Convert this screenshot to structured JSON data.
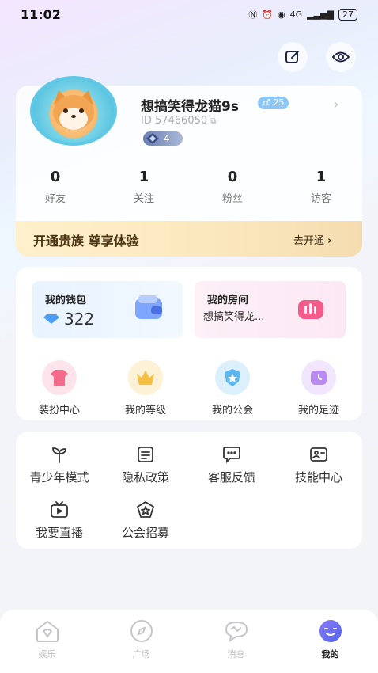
{
  "status": {
    "time": "11:02",
    "network": "4G",
    "battery": "27"
  },
  "profile": {
    "nickname": "想搞笑得龙猫9s",
    "gender_level": "♂ 25",
    "id_text": "ID 57466050",
    "level": "4"
  },
  "stats": [
    {
      "num": "0",
      "label": "好友"
    },
    {
      "num": "1",
      "label": "关注"
    },
    {
      "num": "0",
      "label": "粉丝"
    },
    {
      "num": "1",
      "label": "访客"
    }
  ],
  "vip": {
    "title": "开通贵族 尊享体验",
    "action": "去开通"
  },
  "wallet": {
    "title": "我的钱包",
    "balance": "322"
  },
  "room": {
    "title": "我的房间",
    "subtitle": "想搞笑得龙..."
  },
  "grid": [
    {
      "label": "装扮中心",
      "icon": "shirt-icon",
      "color": "#f56a8a"
    },
    {
      "label": "我的等级",
      "icon": "crown-icon",
      "color": "#f6c043"
    },
    {
      "label": "我的公会",
      "icon": "star-shield-icon",
      "color": "#5ab7ef"
    },
    {
      "label": "我的足迹",
      "icon": "clock-icon",
      "color": "#b98bf0"
    }
  ],
  "services": [
    {
      "label": "青少年模式",
      "icon": "sprout-icon"
    },
    {
      "label": "隐私政策",
      "icon": "document-icon"
    },
    {
      "label": "客服反馈",
      "icon": "chat-icon"
    },
    {
      "label": "技能中心",
      "icon": "id-card-icon"
    },
    {
      "label": "我要直播",
      "icon": "tv-icon"
    },
    {
      "label": "公会招募",
      "icon": "badge-icon"
    }
  ],
  "tabs": [
    {
      "label": "娱乐",
      "icon": "home-icon"
    },
    {
      "label": "广场",
      "icon": "compass-icon"
    },
    {
      "label": "消息",
      "icon": "message-icon"
    },
    {
      "label": "我的",
      "icon": "face-icon"
    }
  ]
}
